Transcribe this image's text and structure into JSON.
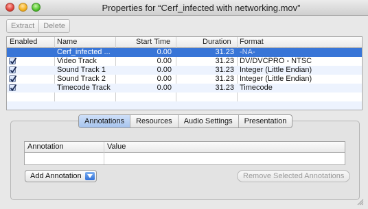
{
  "window": {
    "title": "Properties for “Cerf_infected with networking.mov”"
  },
  "toolbar": {
    "extract_label": "Extract",
    "delete_label": "Delete"
  },
  "tracks_table": {
    "headers": [
      "Enabled",
      "Name",
      "Start Time",
      "Duration",
      "Format"
    ],
    "rows": [
      {
        "enabled": false,
        "name": "Cerf_infected ...",
        "start": "0.00",
        "duration": "31.23",
        "format": "-NA-",
        "selected": true
      },
      {
        "enabled": true,
        "name": "Video Track",
        "start": "0.00",
        "duration": "31.23",
        "format": "DV/DVCPRO - NTSC"
      },
      {
        "enabled": true,
        "name": "Sound Track 1",
        "start": "0.00",
        "duration": "31.23",
        "format": "Integer (Little Endian)"
      },
      {
        "enabled": true,
        "name": "Sound Track 2",
        "start": "0.00",
        "duration": "31.23",
        "format": "Integer (Little Endian)"
      },
      {
        "enabled": true,
        "name": "Timecode Track",
        "start": "0.00",
        "duration": "31.23",
        "format": "Timecode"
      }
    ]
  },
  "tabs": [
    {
      "label": "Annotations",
      "active": true
    },
    {
      "label": "Resources"
    },
    {
      "label": "Audio Settings"
    },
    {
      "label": "Presentation"
    }
  ],
  "annotations_table": {
    "headers": [
      "Annotation",
      "Value"
    ]
  },
  "buttons": {
    "add_annotation": "Add Annotation",
    "remove_selected": "Remove Selected Annotations"
  },
  "colors": {
    "selection": "#3875d7",
    "row_alt": "#edf3fe"
  }
}
